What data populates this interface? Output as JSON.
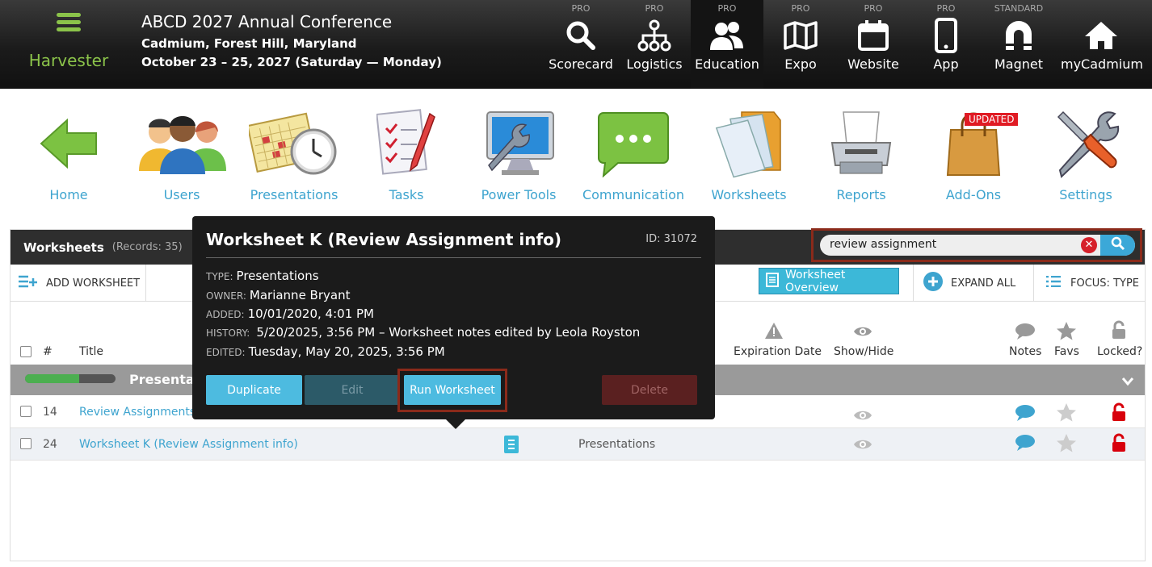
{
  "brand": {
    "name": "Harvester",
    "accent": "#8bc34a"
  },
  "conference": {
    "title": "ABCD 2027 Annual Conference",
    "location": "Cadmium, Forest Hill, Maryland",
    "dates": "October 23 – 25, 2027 (Saturday — Monday)"
  },
  "topnav": [
    {
      "tier": "PRO",
      "label": "Scorecard",
      "icon": "search-icon"
    },
    {
      "tier": "PRO",
      "label": "Logistics",
      "icon": "sitemap-icon"
    },
    {
      "tier": "PRO",
      "label": "Education",
      "icon": "people-icon",
      "active": true
    },
    {
      "tier": "PRO",
      "label": "Expo",
      "icon": "map-icon"
    },
    {
      "tier": "PRO",
      "label": "Website",
      "icon": "calendar-icon"
    },
    {
      "tier": "PRO",
      "label": "App",
      "icon": "mobile-icon"
    },
    {
      "tier": "STANDARD",
      "label": "Magnet",
      "icon": "magnet-icon"
    },
    {
      "tier": "",
      "label": "myCadmium",
      "icon": "home-icon"
    }
  ],
  "apps": [
    {
      "label": "Home",
      "icon": "back-arrow-icon"
    },
    {
      "label": "Users",
      "icon": "users-icon"
    },
    {
      "label": "Presentations",
      "icon": "calendar-clock-icon"
    },
    {
      "label": "Tasks",
      "icon": "checklist-icon"
    },
    {
      "label": "Power Tools",
      "icon": "wrench-monitor-icon"
    },
    {
      "label": "Communication",
      "icon": "chat-bubble-icon"
    },
    {
      "label": "Worksheets",
      "icon": "documents-icon"
    },
    {
      "label": "Reports",
      "icon": "printer-icon"
    },
    {
      "label": "Add-Ons",
      "icon": "shopping-bag-icon",
      "badge": "UPDATED"
    },
    {
      "label": "Settings",
      "icon": "tools-icon"
    }
  ],
  "panel": {
    "title": "Worksheets",
    "records": "(Records: 35)"
  },
  "search": {
    "value": "review assignment",
    "clear": "✕"
  },
  "toolbar": {
    "add": "ADD WORKSHEET",
    "overview": "Worksheet Overview",
    "expand": "EXPAND ALL",
    "focus": "FOCUS: TYPE"
  },
  "columns": {
    "num": "#",
    "title": "Title",
    "expiration": "Expiration Date",
    "showhide": "Show/Hide",
    "notes": "Notes",
    "favs": "Favs",
    "locked": "Locked?"
  },
  "group": {
    "name": "Presentations",
    "progress": 0.6
  },
  "rows": [
    {
      "num": "14",
      "title": "Review Assignments - ",
      "type": ""
    },
    {
      "num": "24",
      "title": "Worksheet K (Review Assignment info)",
      "type": "Presentations"
    }
  ],
  "popup": {
    "title": "Worksheet K (Review Assignment info)",
    "id": "ID: 31072",
    "type_label": "TYPE:",
    "type": "Presentations",
    "owner_label": "OWNER:",
    "owner": "Marianne Bryant",
    "added_label": "ADDED:",
    "added": "10/01/2020, 4:01 PM",
    "history_label": "HISTORY:",
    "history": "5/20/2025, 3:56 PM – Worksheet notes edited by Leola Royston",
    "edited_label": "EDITED:",
    "edited": "Tuesday, May 20, 2025, 3:56 PM",
    "buttons": {
      "duplicate": "Duplicate",
      "edit": "Edit",
      "run": "Run Worksheet",
      "delete": "Delete"
    }
  }
}
